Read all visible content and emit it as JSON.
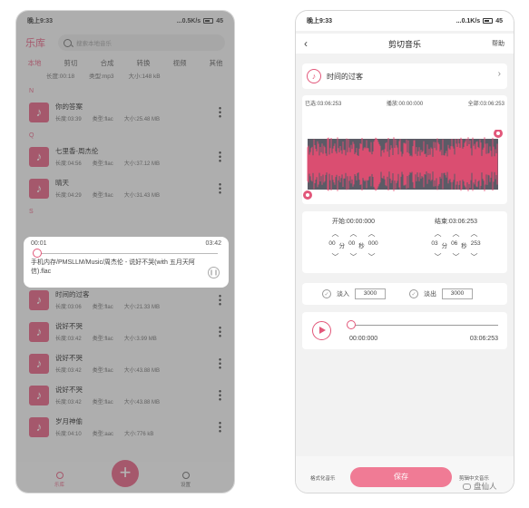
{
  "left_phone": {
    "status": {
      "time": "晚上9:33",
      "network": "...0.5K/s",
      "battery": "45"
    },
    "app_title": "乐库",
    "search_placeholder": "搜索本地音乐",
    "tabs": [
      "本地",
      "剪切",
      "合成",
      "转换",
      "视频",
      "其他"
    ],
    "top_partial": {
      "duration": "长度:00:18",
      "type": "类型:mp3",
      "size": "大小:148 kB"
    },
    "sections": [
      {
        "letter": "N",
        "items": [
          {
            "title": "你的答案",
            "duration": "长度:03:39",
            "type": "类型:flac",
            "size": "大小:25.48 MB"
          }
        ]
      },
      {
        "letter": "Q",
        "items": [
          {
            "title": "七里香-周杰伦",
            "duration": "长度:04:56",
            "type": "类型:flac",
            "size": "大小:37.12 MB"
          },
          {
            "title": "晴天",
            "duration": "长度:04:29",
            "type": "类型:flac",
            "size": "大小:31.43 MB"
          }
        ]
      },
      {
        "letter": "S",
        "items": []
      }
    ],
    "lower_items": [
      {
        "title": "时间的过客",
        "duration": "长度:03:06",
        "type": "类型:flac",
        "size": "大小:21.33 MB"
      },
      {
        "title": "说好不哭",
        "duration": "长度:03:42",
        "type": "类型:flac",
        "size": "大小:3.99 MB"
      },
      {
        "title": "说好不哭",
        "duration": "长度:03:42",
        "type": "类型:flac",
        "size": "大小:43.88 MB"
      },
      {
        "title": "说好不哭",
        "duration": "长度:03:42",
        "type": "类型:flac",
        "size": "大小:43.88 MB"
      },
      {
        "title": "岁月神偷",
        "duration": "长度:04:10",
        "type": "类型:aac",
        "size": "大小:776 kB"
      }
    ],
    "popup": {
      "elapsed": "00:01",
      "total": "03:42",
      "progress": 0.005,
      "path": "手机内存/PMSLLM/Music/周杰伦 - 说好不哭(with 五月天阿信).flac"
    },
    "nav": {
      "library": "乐库",
      "settings": "设置"
    }
  },
  "right_phone": {
    "status": {
      "time": "晚上9:33",
      "network": "...0.1K/s",
      "battery": "45"
    },
    "title": "剪切音乐",
    "help": "帮助",
    "song": "时间的过客",
    "selected": "已选:03:06:253",
    "playing": "播放:00:00:000",
    "total": "全部:03:06:253",
    "start_label": "开始:00:00:000",
    "end_label": "结束:03:06:253",
    "start_digits": [
      "00",
      "分",
      "00",
      "秒",
      "000"
    ],
    "end_digits": [
      "03",
      "分",
      "06",
      "秒",
      "253"
    ],
    "fade_in_label": "淡入",
    "fade_in_value": "3000",
    "fade_out_label": "淡出",
    "fade_out_value": "3000",
    "play_start": "00:00:000",
    "play_end": "03:06:253",
    "format_btn": "格式化音乐",
    "save_btn": "保存",
    "rename_btn": "剪辑中文音乐",
    "colors": {
      "accent": "#e2577a",
      "wave": "#e84d73"
    }
  },
  "watermark": "盘仙人"
}
